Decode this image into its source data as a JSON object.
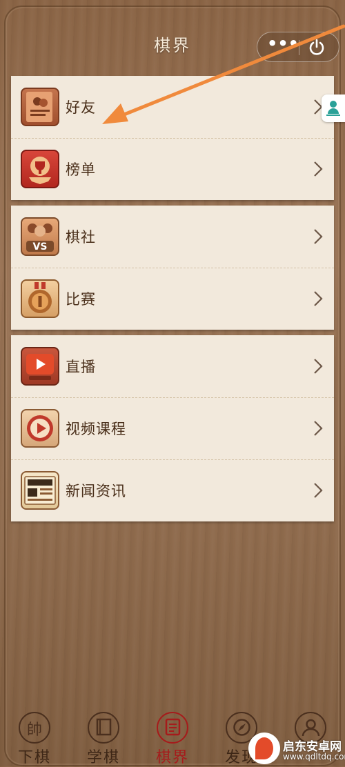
{
  "header": {
    "title": "棋界",
    "more_icon": "more-dots-icon",
    "close_icon": "power-icon"
  },
  "groups": [
    {
      "items": [
        {
          "label": "好友",
          "icon": "friends-book-icon"
        },
        {
          "label": "榜单",
          "icon": "trophy-banner-icon"
        }
      ]
    },
    {
      "items": [
        {
          "label": "棋社",
          "icon": "vs-club-icon"
        },
        {
          "label": "比赛",
          "icon": "medal-icon"
        }
      ]
    },
    {
      "items": [
        {
          "label": "直播",
          "icon": "tv-play-icon"
        },
        {
          "label": "视频课程",
          "icon": "video-play-icon"
        },
        {
          "label": "新闻资讯",
          "icon": "newspaper-icon"
        }
      ]
    }
  ],
  "side_badge": {
    "icon": "person-location-icon"
  },
  "tabbar": {
    "tabs": [
      {
        "label": "下棋",
        "icon": "piece-shuai-icon",
        "active": false
      },
      {
        "label": "学棋",
        "icon": "book-icon",
        "active": false
      },
      {
        "label": "棋界",
        "icon": "document-icon",
        "active": true
      },
      {
        "label": "发现",
        "icon": "compass-icon",
        "active": false
      },
      {
        "label": "",
        "icon": "profile-icon",
        "active": false
      }
    ],
    "piece_char": "帥"
  },
  "watermark": {
    "title": "启东安卓网",
    "url": "www.qdltdq.com"
  },
  "colors": {
    "accent": "#a61b1b",
    "panel": "#f2e9dc",
    "text": "#4a2f1a",
    "arrow": "#f08a3c"
  }
}
